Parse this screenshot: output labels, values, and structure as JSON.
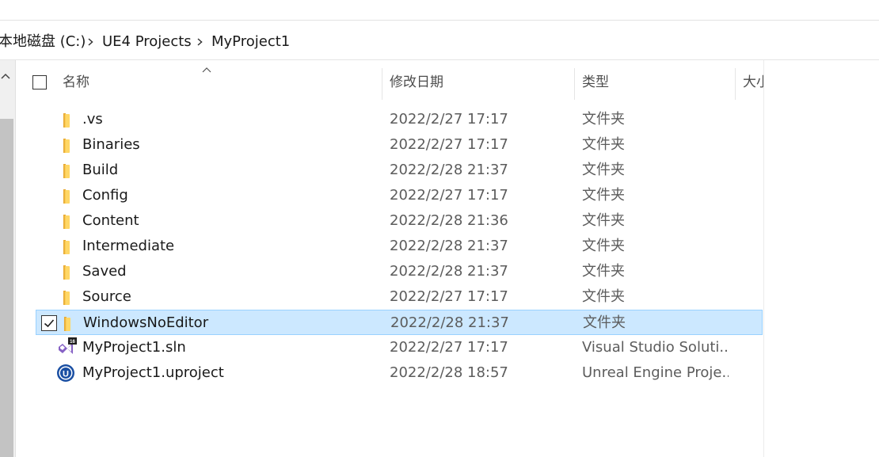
{
  "breadcrumb": {
    "items": [
      "本地磁盘 (C:)",
      "UE4 Projects",
      "MyProject1"
    ]
  },
  "columns": {
    "name": "名称",
    "date": "修改日期",
    "type": "类型",
    "size": "大小"
  },
  "rows": [
    {
      "name": ".vs",
      "date": "2022/2/27 17:17",
      "type": "文件夹",
      "icon": "folder-icon"
    },
    {
      "name": "Binaries",
      "date": "2022/2/27 17:17",
      "type": "文件夹",
      "icon": "folder-icon"
    },
    {
      "name": "Build",
      "date": "2022/2/28 21:37",
      "type": "文件夹",
      "icon": "folder-icon"
    },
    {
      "name": "Config",
      "date": "2022/2/27 17:17",
      "type": "文件夹",
      "icon": "folder-icon"
    },
    {
      "name": "Content",
      "date": "2022/2/28 21:36",
      "type": "文件夹",
      "icon": "folder-icon"
    },
    {
      "name": "Intermediate",
      "date": "2022/2/28 21:37",
      "type": "文件夹",
      "icon": "folder-icon"
    },
    {
      "name": "Saved",
      "date": "2022/2/28 21:37",
      "type": "文件夹",
      "icon": "folder-icon"
    },
    {
      "name": "Source",
      "date": "2022/2/27 17:17",
      "type": "文件夹",
      "icon": "folder-icon"
    },
    {
      "name": "WindowsNoEditor",
      "date": "2022/2/28 21:37",
      "type": "文件夹",
      "icon": "folder-icon",
      "selected": true
    },
    {
      "name": "MyProject1.sln",
      "date": "2022/2/27 17:17",
      "type": "Visual Studio Soluti...",
      "icon": "visual-studio-solution-icon",
      "badge": "16"
    },
    {
      "name": "MyProject1.uproject",
      "date": "2022/2/28 18:57",
      "type": "Unreal Engine Proje...",
      "icon": "unreal-engine-icon",
      "badge": "U"
    }
  ],
  "colors": {
    "selection_fill": "#cce8ff",
    "selection_border": "#99d1ff",
    "folder_yellow": "#ffd766"
  }
}
